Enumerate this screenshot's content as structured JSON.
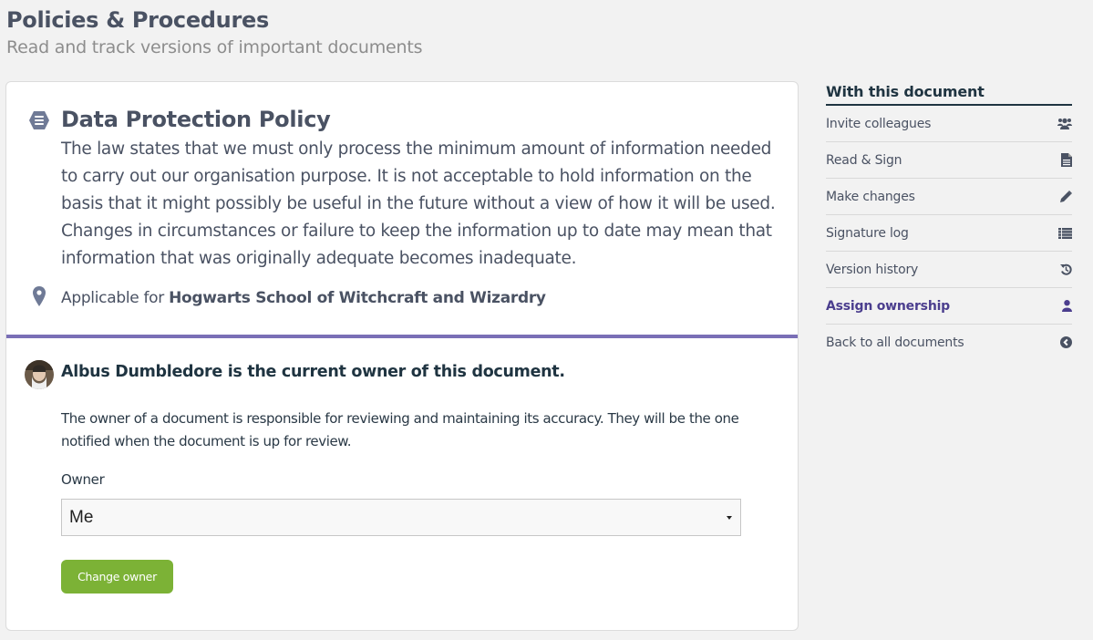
{
  "header": {
    "title": "Policies & Procedures",
    "subtitle": "Read and track versions of important documents"
  },
  "document": {
    "icon": "list-circle-icon",
    "title": "Data Protection Policy",
    "body": "The law states that we must only process the minimum amount of information needed to carry out our organisation purpose. It is not acceptable to hold information on the basis that it might possibly be useful in the future without a view of how it will be used. Changes in circumstances or failure to keep the information up to date may mean that information that was originally adequate becomes inadequate.",
    "applicable_prefix": "Applicable for",
    "applicable_org": "Hogwarts School of Witchcraft and Wizardry"
  },
  "ownership": {
    "heading": "Albus Dumbledore is the current owner of this document.",
    "description": "The owner of a document is responsible for reviewing and maintaining its accuracy. They will be the one notified when the document is up for review.",
    "owner_label": "Owner",
    "owner_value": "Me",
    "change_button": "Change owner"
  },
  "sidebar": {
    "heading": "With this document",
    "items": [
      {
        "label": "Invite colleagues",
        "icon": "users-icon",
        "active": false
      },
      {
        "label": "Read & Sign",
        "icon": "file-icon",
        "active": false
      },
      {
        "label": "Make changes",
        "icon": "pencil-icon",
        "active": false
      },
      {
        "label": "Signature log",
        "icon": "list-icon",
        "active": false
      },
      {
        "label": "Version history",
        "icon": "history-icon",
        "active": false
      },
      {
        "label": "Assign ownership",
        "icon": "user-icon",
        "active": true
      },
      {
        "label": "Back to all documents",
        "icon": "chevron-left-circle-icon",
        "active": false
      }
    ]
  },
  "colors": {
    "accent": "#7a6fb6",
    "active_link": "#4b3e8e",
    "button": "#7cb236",
    "text": "#4a5263"
  }
}
